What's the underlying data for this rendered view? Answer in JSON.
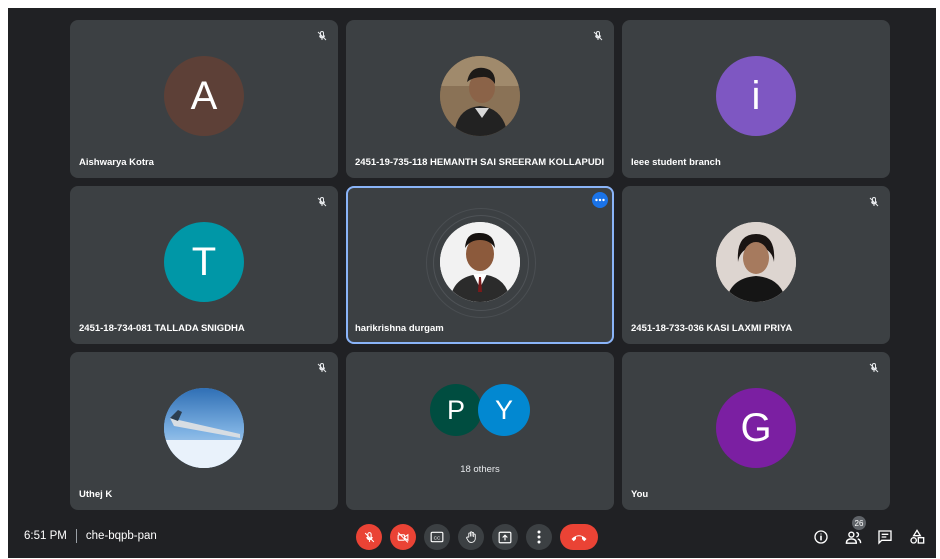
{
  "tiles": [
    {
      "name": "Aishwarya Kotra",
      "initial": "A",
      "color": "#5d4037"
    },
    {
      "name": "2451-19-735-118 HEMANTH SAI SREERAM KOLLAPUDI"
    },
    {
      "name": "Ieee student branch",
      "initial": "i",
      "color": "#7e57c2"
    },
    {
      "name": "2451-18-734-081 TALLADA SNIGDHA",
      "initial": "T",
      "color": "#0097a7"
    },
    {
      "name": "harikrishna durgam"
    },
    {
      "name": "2451-18-733-036 KASI LAXMI PRIYA"
    },
    {
      "name": "Uthej K"
    },
    {
      "others": "18 others",
      "initials": [
        "P",
        "Y"
      ],
      "colors": [
        "#004d40",
        "#0288d1"
      ]
    },
    {
      "name": "You",
      "initial": "G",
      "color": "#7b1fa2"
    }
  ],
  "bottom": {
    "time": "6:51 PM",
    "meeting_code": "che-bqpb-pan",
    "participant_count": "26"
  },
  "icons": [
    "mic-off-icon",
    "camera-off-icon",
    "captions-icon",
    "raise-hand-icon",
    "present-icon",
    "more-vert-icon",
    "end-call-icon",
    "info-icon",
    "people-icon",
    "chat-icon",
    "activities-icon"
  ]
}
